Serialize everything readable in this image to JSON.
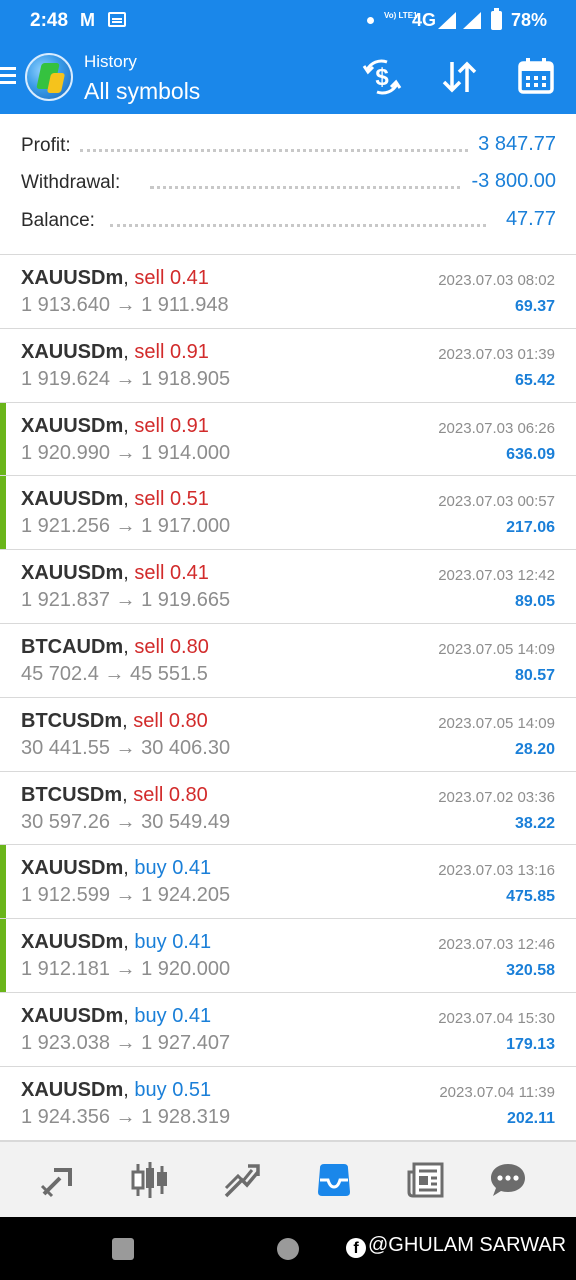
{
  "status_bar": {
    "time": "2:48",
    "gmail_glyph": "M",
    "volte_label": "Vo) LTE1",
    "network": "4G",
    "battery": "78%"
  },
  "app_bar": {
    "subtitle": "History",
    "title": "All symbols",
    "icons": [
      "menu-icon",
      "metatrader-logo",
      "currency-exchange-icon",
      "sort-icon",
      "calendar-icon"
    ]
  },
  "summary": {
    "profit_label": "Profit:",
    "profit_value": "3 847.77",
    "withdrawal_label": "Withdrawal:",
    "withdrawal_value": "-3 800.00",
    "balance_label": "Balance:",
    "balance_value": "47.77"
  },
  "trades": [
    {
      "symbol": "XAUUSDm",
      "type": "sell",
      "volume": "0.41",
      "open": "1 913.640",
      "close": "1 911.948",
      "time": "2023.07.03 08:02",
      "profit": "69.37",
      "marked": false
    },
    {
      "symbol": "XAUUSDm",
      "type": "sell",
      "volume": "0.91",
      "open": "1 919.624",
      "close": "1 918.905",
      "time": "2023.07.03 01:39",
      "profit": "65.42",
      "marked": false
    },
    {
      "symbol": "XAUUSDm",
      "type": "sell",
      "volume": "0.91",
      "open": "1 920.990",
      "close": "1 914.000",
      "time": "2023.07.03 06:26",
      "profit": "636.09",
      "marked": true
    },
    {
      "symbol": "XAUUSDm",
      "type": "sell",
      "volume": "0.51",
      "open": "1 921.256",
      "close": "1 917.000",
      "time": "2023.07.03 00:57",
      "profit": "217.06",
      "marked": true
    },
    {
      "symbol": "XAUUSDm",
      "type": "sell",
      "volume": "0.41",
      "open": "1 921.837",
      "close": "1 919.665",
      "time": "2023.07.03 12:42",
      "profit": "89.05",
      "marked": false
    },
    {
      "symbol": "BTCAUDm",
      "type": "sell",
      "volume": "0.80",
      "open": "45 702.4",
      "close": "45 551.5",
      "time": "2023.07.05 14:09",
      "profit": "80.57",
      "marked": false
    },
    {
      "symbol": "BTCUSDm",
      "type": "sell",
      "volume": "0.80",
      "open": "30 441.55",
      "close": "30 406.30",
      "time": "2023.07.05 14:09",
      "profit": "28.20",
      "marked": false
    },
    {
      "symbol": "BTCUSDm",
      "type": "sell",
      "volume": "0.80",
      "open": "30 597.26",
      "close": "30 549.49",
      "time": "2023.07.02 03:36",
      "profit": "38.22",
      "marked": false
    },
    {
      "symbol": "XAUUSDm",
      "type": "buy",
      "volume": "0.41",
      "open": "1 912.599",
      "close": "1 924.205",
      "time": "2023.07.03 13:16",
      "profit": "475.85",
      "marked": true
    },
    {
      "symbol": "XAUUSDm",
      "type": "buy",
      "volume": "0.41",
      "open": "1 912.181",
      "close": "1 920.000",
      "time": "2023.07.03 12:46",
      "profit": "320.58",
      "marked": true
    },
    {
      "symbol": "XAUUSDm",
      "type": "buy",
      "volume": "0.41",
      "open": "1 923.038",
      "close": "1 927.407",
      "time": "2023.07.04 15:30",
      "profit": "179.13",
      "marked": false
    },
    {
      "symbol": "XAUUSDm",
      "type": "buy",
      "volume": "0.51",
      "open": "1 924.356",
      "close": "1 928.319",
      "time": "2023.07.04 11:39",
      "profit": "202.11",
      "marked": false
    }
  ],
  "bottom_nav": {
    "items": [
      "quotes-icon",
      "chart-candles-icon",
      "trade-icon",
      "history-icon",
      "news-icon",
      "messages-icon"
    ],
    "active": "history-icon"
  },
  "system_nav": {
    "watermark": "@GHULAM SARWAR"
  },
  "colors": {
    "accent": "#1a87ea",
    "sell": "#d22b2b",
    "buy": "#1a7fd8",
    "marker": "#6ab51a"
  }
}
